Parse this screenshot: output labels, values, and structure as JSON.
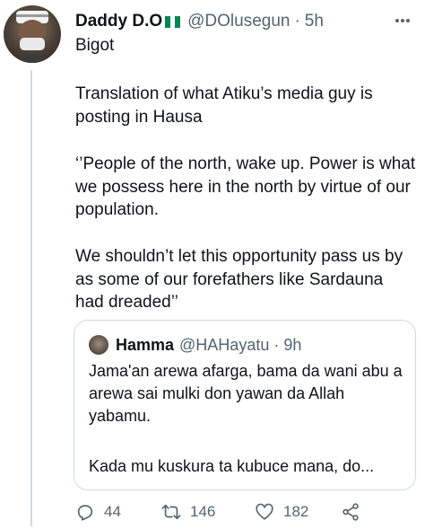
{
  "author": {
    "display_name": "Daddy D.O",
    "flag_icon": "nigeria-flag-icon",
    "handle": "@DOlusegun",
    "separator": "·",
    "time": "5h"
  },
  "tweet": {
    "paragraphs": [
      "Bigot",
      "Translation of what Atiku’s media guy is posting in Hausa",
      "‘’People of the north, wake up. Power is what we possess here in the north by virtue of our population.",
      "We shouldn’t let this opportunity pass us by as some of our forefathers like Sardauna had dreaded’’"
    ]
  },
  "quoted_tweet": {
    "display_name": "Hamma",
    "handle": "@HAHayatu",
    "separator": "·",
    "time": "9h",
    "paragraphs": [
      "Jama'an arewa afarga, bama da wani abu a arewa sai mulki don yawan da Allah yabamu.",
      "Kada mu kuskura ta kubuce mana, do..."
    ]
  },
  "actions": {
    "replies": "44",
    "retweets": "146",
    "likes": "182"
  },
  "colors": {
    "text": "#0f1419",
    "secondary": "#536471",
    "border": "#cfd9de",
    "flag_green": "#008751"
  }
}
